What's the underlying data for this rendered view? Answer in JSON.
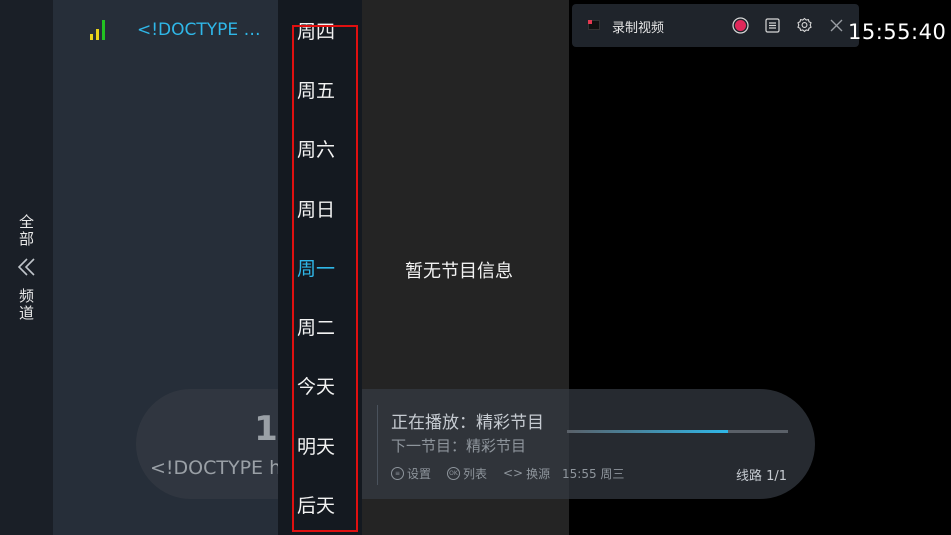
{
  "rail": {
    "top_label": "全\n部",
    "bottom_label": "频\n道"
  },
  "channel": {
    "name": "<!DOCTYPE html><html>"
  },
  "days": [
    {
      "label": "周四",
      "active": false
    },
    {
      "label": "周五",
      "active": false
    },
    {
      "label": "周六",
      "active": false
    },
    {
      "label": "周日",
      "active": false
    },
    {
      "label": "周一",
      "active": true
    },
    {
      "label": "周二",
      "active": false
    },
    {
      "label": "今天",
      "active": false
    },
    {
      "label": "明天",
      "active": false
    },
    {
      "label": "后天",
      "active": false
    }
  ],
  "program_panel": {
    "empty_text": "暂无节目信息"
  },
  "info_bar": {
    "number": "1",
    "channel_name": "<!DOCTYPE html><html>",
    "now_playing": "正在播放：精彩节目",
    "next_program": "下一节目：精彩节目",
    "progress": 0.73,
    "hints": [
      {
        "icon": "menu",
        "icon_text": "≡",
        "label": "设置"
      },
      {
        "icon": "ok",
        "icon_text": "OK",
        "label": "列表"
      },
      {
        "icon": "left-right-arrows",
        "icon_text": "<>",
        "label": "换源"
      }
    ],
    "time": "15:55 周三",
    "route": "线路 1/1"
  },
  "record_bar": {
    "label": "录制视频"
  },
  "clock": "15:55:40",
  "colors": {
    "accent": "#2fb7e8",
    "highlight_border": "#e01010",
    "record_red": "#e53950",
    "signal_green": "#22c322",
    "signal_yellow": "#e8d21a"
  }
}
